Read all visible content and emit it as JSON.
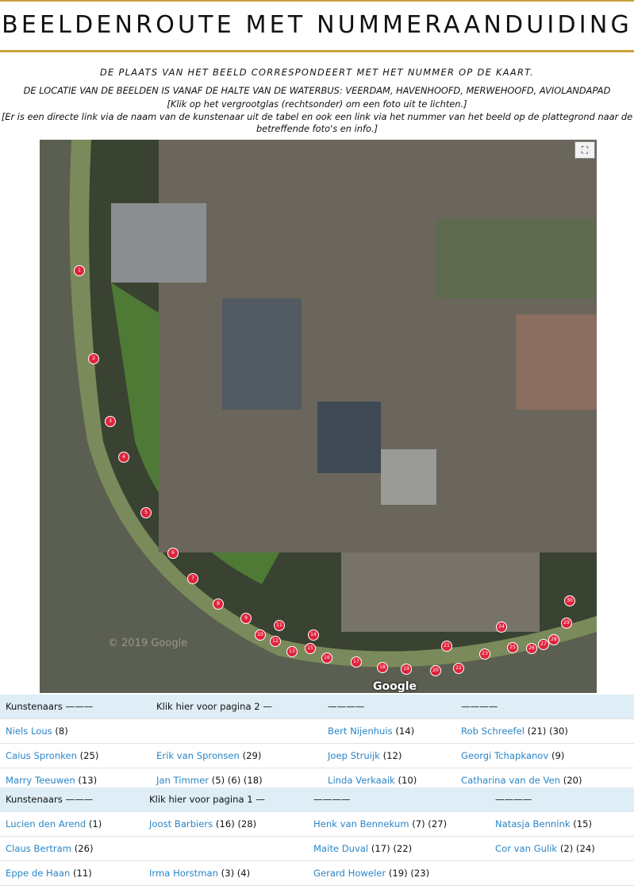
{
  "title": "BEELDENROUTE MET NUMMERAANDUIDING",
  "intro": {
    "line1": "DE PLAATS VAN HET BEELD CORRESPONDEERT MET HET NUMMER OP DE KAART.",
    "line2": "DE LOCATIE VAN DE BEELDEN IS VANAF DE HALTE VAN DE WATERBUS: VEERDAM, HAVENHOOFD, MERWEHOOFD, AVIOLANDAPAD",
    "line3": "[Klik op het vergrootglas (rechtsonder) om een foto uit te lichten.]",
    "line4": "[Er is een directe link via de naam van de kunstenaar uit de tabel en ook een link via het nummer van het beeld op de plattegrond naar de betreffende foto's en info.]"
  },
  "map": {
    "copyright": "© 2019 Google",
    "logo": "Google",
    "markers": [
      "1",
      "2",
      "3",
      "4",
      "5",
      "6",
      "7",
      "8",
      "9",
      "10",
      "11",
      "12",
      "13",
      "14",
      "15",
      "16",
      "17",
      "18",
      "19",
      "20",
      "21",
      "22",
      "23",
      "24",
      "25",
      "26",
      "27",
      "28",
      "29",
      "30"
    ]
  },
  "table1": {
    "header": [
      "Kunstenaars ———",
      "Klik hier voor pagina 2 —",
      "————",
      "————"
    ],
    "rows": [
      [
        {
          "name": "Niels Lous",
          "nums": "(8)"
        },
        {
          "name": "",
          "nums": ""
        },
        {
          "name": "Bert Nijenhuis",
          "nums": "(14)"
        },
        {
          "name": "Rob Schreefel",
          "nums": "(21) (30)"
        }
      ],
      [
        {
          "name": "Caius Spronken",
          "nums": "(25)"
        },
        {
          "name": "Erik van Spronsen",
          "nums": "(29)"
        },
        {
          "name": "Joep Struijk",
          "nums": "(12)"
        },
        {
          "name": "Georgi Tchapkanov",
          "nums": "(9)"
        }
      ],
      [
        {
          "name": "Marry Teeuwen",
          "nums": "(13)"
        },
        {
          "name": "Jan Timmer",
          "nums": "(5) (6) (18)"
        },
        {
          "name": "Linda Verkaaik",
          "nums": "(10)"
        },
        {
          "name": "Catharina van de Ven",
          "nums": "(20)"
        }
      ]
    ]
  },
  "table2": {
    "header": [
      "Kunstenaars ———",
      "Klik hier voor pagina 1 —",
      "————",
      "————"
    ],
    "rows": [
      [
        {
          "name": "Lucien den Arend",
          "nums": "(1)"
        },
        {
          "name": "Joost Barbiers",
          "nums": "(16) (28)"
        },
        {
          "name": "Henk van Bennekum",
          "nums": "(7) (27)"
        },
        {
          "name": "Natasja Bennink",
          "nums": "(15)"
        }
      ],
      [
        {
          "name": "Claus Bertram",
          "nums": "(26)"
        },
        {
          "name": "",
          "nums": ""
        },
        {
          "name": "Maite Duval",
          "nums": "(17) (22)"
        },
        {
          "name": "Cor van Gulik",
          "nums": "(2) (24)"
        }
      ],
      [
        {
          "name": "Eppe de Haan",
          "nums": "(11)"
        },
        {
          "name": "Irma Horstman",
          "nums": "(3) (4)"
        },
        {
          "name": "Gerard Howeler",
          "nums": "(19) (23)"
        },
        {
          "name": "",
          "nums": ""
        }
      ]
    ]
  }
}
